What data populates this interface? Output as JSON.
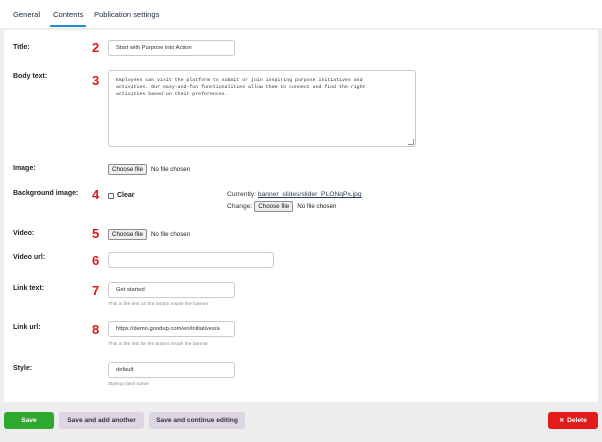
{
  "tabs": [
    {
      "label": "General",
      "active": false
    },
    {
      "label": "Contents",
      "active": true
    },
    {
      "label": "Publication settings",
      "active": false
    }
  ],
  "fields": {
    "title": {
      "label": "Title:",
      "marker": "2",
      "value": "Start with Purpose into Action"
    },
    "body": {
      "label": "Body text:",
      "marker": "3",
      "lines": [
        "Employees can visit the platform to submit or join inspiring purpose initiatives and",
        "activities. Our easy-and-fun functionalities allow them to connect and find the right",
        "activities based on their preferences."
      ]
    },
    "image": {
      "label": "Image:",
      "button": "Choose file",
      "status": "No file chosen"
    },
    "background": {
      "label": "Background image:",
      "marker": "4",
      "clear_label": "Clear",
      "currently_label": "Currently:",
      "currently_link": "banner_slides/slider_PLONqPx.jpg",
      "change_label": "Change:",
      "button": "Choose file",
      "status": "No file chosen"
    },
    "video": {
      "label": "Video:",
      "marker": "5",
      "button": "Choose file",
      "status": "No file chosen"
    },
    "video_url": {
      "label": "Video url:",
      "marker": "6",
      "value": ""
    },
    "link_text": {
      "label": "Link text:",
      "marker": "7",
      "value": "Get started",
      "help": "This is the text on the button inside the banner"
    },
    "link_url": {
      "label": "Link url:",
      "marker": "8",
      "value": "https://demo.goodup.com/en/initiatives/a",
      "help": "This is the link for the button inside the banner"
    },
    "style": {
      "label": "Style:",
      "value": "default",
      "help": "Styling class name"
    }
  },
  "footer": {
    "save": "Save",
    "save_add": "Save and add another",
    "save_continue": "Save and continue editing",
    "delete_icon": "✕",
    "delete": "Delete"
  },
  "colors": {
    "save": "#2ea82e",
    "delete": "#e31b1b",
    "marker": "#e01818",
    "tab_underline": "#1f8fd4"
  }
}
